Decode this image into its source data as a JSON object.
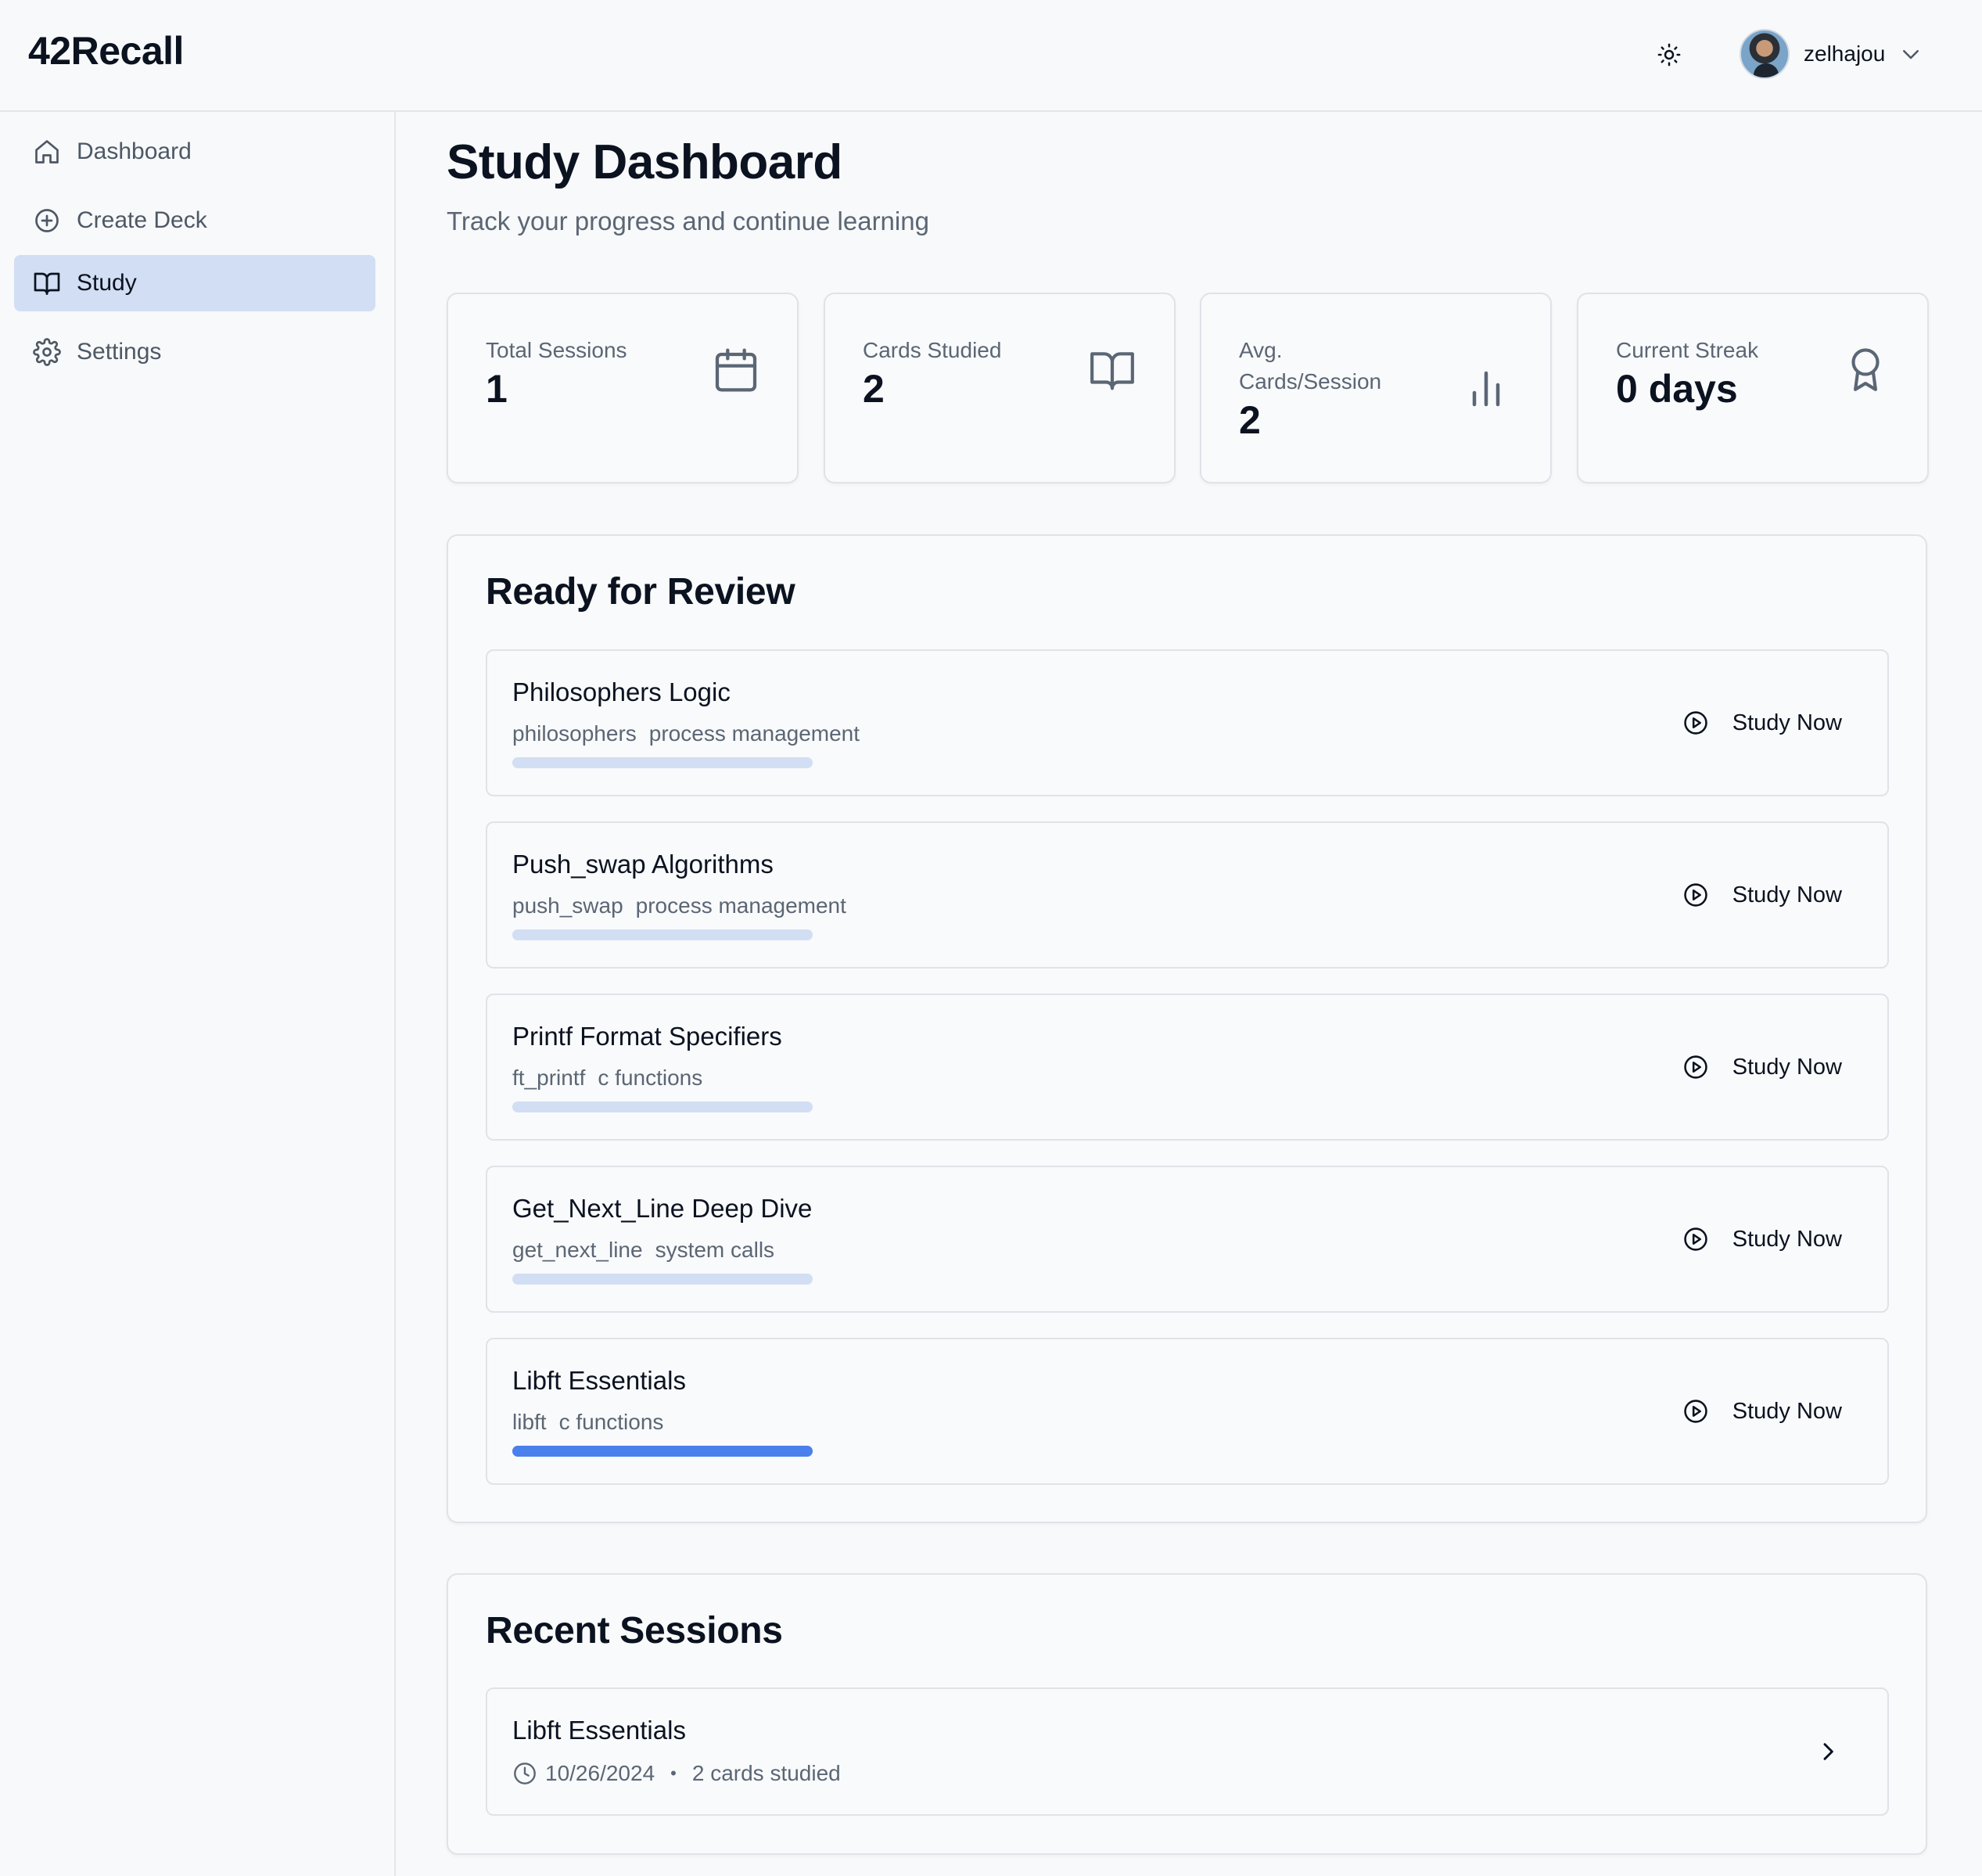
{
  "app": {
    "logo": "42Recall"
  },
  "header": {
    "username": "zelhajou"
  },
  "sidebar": {
    "items": [
      {
        "label": "Dashboard",
        "icon": "home-icon",
        "active": false
      },
      {
        "label": "Create Deck",
        "icon": "plus-circle-icon",
        "active": false
      },
      {
        "label": "Study",
        "icon": "book-open-icon",
        "active": true
      },
      {
        "label": "Settings",
        "icon": "gear-icon",
        "active": false
      }
    ]
  },
  "page": {
    "title": "Study Dashboard",
    "subtitle": "Track your progress and continue learning"
  },
  "stats": [
    {
      "label": "Total Sessions",
      "value": "1",
      "icon": "calendar-icon"
    },
    {
      "label": "Cards Studied",
      "value": "2",
      "icon": "book-open-icon"
    },
    {
      "label": "Avg. Cards/Session",
      "value": "2",
      "icon": "bar-chart-icon"
    },
    {
      "label": "Current Streak",
      "value": "0 days",
      "icon": "award-icon"
    }
  ],
  "review": {
    "title": "Ready for Review",
    "button_label": "Study Now",
    "decks": [
      {
        "title": "Philosophers Logic",
        "tags": [
          "philosophers",
          "process management"
        ],
        "progress": 0
      },
      {
        "title": "Push_swap Algorithms",
        "tags": [
          "push_swap",
          "process management"
        ],
        "progress": 0
      },
      {
        "title": "Printf Format Specifiers",
        "tags": [
          "ft_printf",
          "c functions"
        ],
        "progress": 0
      },
      {
        "title": "Get_Next_Line Deep Dive",
        "tags": [
          "get_next_line",
          "system calls"
        ],
        "progress": 0
      },
      {
        "title": "Libft Essentials",
        "tags": [
          "libft",
          "c functions"
        ],
        "progress": 1
      }
    ]
  },
  "recent": {
    "title": "Recent Sessions",
    "sessions": [
      {
        "title": "Libft Essentials",
        "date": "10/26/2024",
        "cards": "2 cards studied"
      }
    ]
  },
  "colors": {
    "accent": "#4a80ec",
    "active_nav_bg": "#d2def3",
    "progress_track": "#d2def3"
  }
}
